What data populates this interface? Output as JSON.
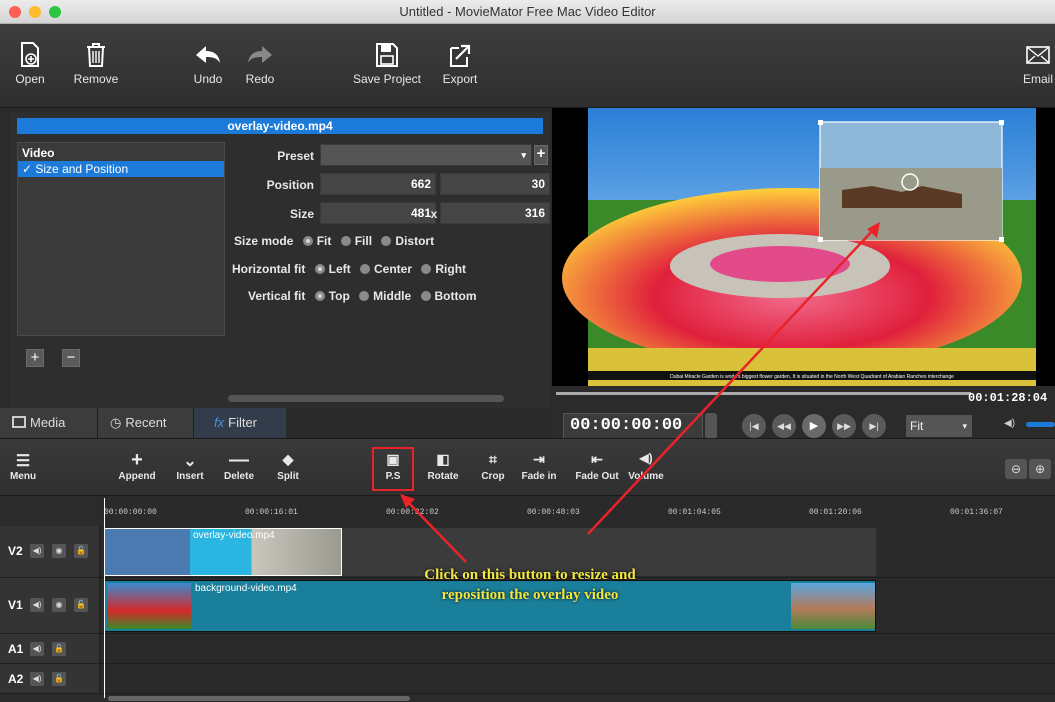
{
  "window": {
    "title": "Untitled - MovieMator Free Mac Video Editor"
  },
  "toolbar": {
    "open": "Open",
    "remove": "Remove",
    "undo": "Undo",
    "redo": "Redo",
    "save_project": "Save Project",
    "export": "Export",
    "email": "Email"
  },
  "filter_panel": {
    "file_name": "overlay-video.mp4",
    "list_header": "Video",
    "list_item": "Size and Position",
    "preset_label": "Preset",
    "preset_value": "",
    "position_label": "Position",
    "position_x": "662",
    "position_sep": ",",
    "position_y": "30",
    "size_label": "Size",
    "size_w": "481",
    "size_sep": "x",
    "size_h": "316",
    "size_mode_label": "Size mode",
    "size_mode_options": [
      "Fit",
      "Fill",
      "Distort"
    ],
    "hfit_label": "Horizontal fit",
    "hfit_options": [
      "Left",
      "Center",
      "Right"
    ],
    "vfit_label": "Vertical fit",
    "vfit_options": [
      "Top",
      "Middle",
      "Bottom"
    ]
  },
  "tabs": {
    "media": "Media",
    "recent": "Recent",
    "filter": "Filter"
  },
  "viewer": {
    "duration": "00:01:28:04",
    "timecode": "00:00:00:00",
    "zoom": "Fit",
    "caption": "Dubai Miracle Garden is world's biggest flower garden, It is situated in the North West Quadrant of Arabian Ranches interchange"
  },
  "timeline_toolbar": {
    "menu": "Menu",
    "append": "Append",
    "insert": "Insert",
    "delete": "Delete",
    "split": "Split",
    "ps": "P.S",
    "rotate": "Rotate",
    "crop": "Crop",
    "fade_in": "Fade in",
    "fade_out": "Fade Out",
    "volume": "Volume"
  },
  "ruler": [
    "00:00:00:00",
    "00:00:16:01",
    "00:00:32:02",
    "00:00:48:03",
    "00:01:04:05",
    "00:01:20:06",
    "00:01:36:07"
  ],
  "tracks": {
    "v2": {
      "label": "V2",
      "clip": "overlay-video.mp4"
    },
    "v1": {
      "label": "V1",
      "clip": "background-video.mp4"
    },
    "a1": {
      "label": "A1"
    },
    "a2": {
      "label": "A2"
    }
  },
  "annotation": {
    "line1": "Click on this button to resize and",
    "line2": "reposition the overlay video"
  }
}
